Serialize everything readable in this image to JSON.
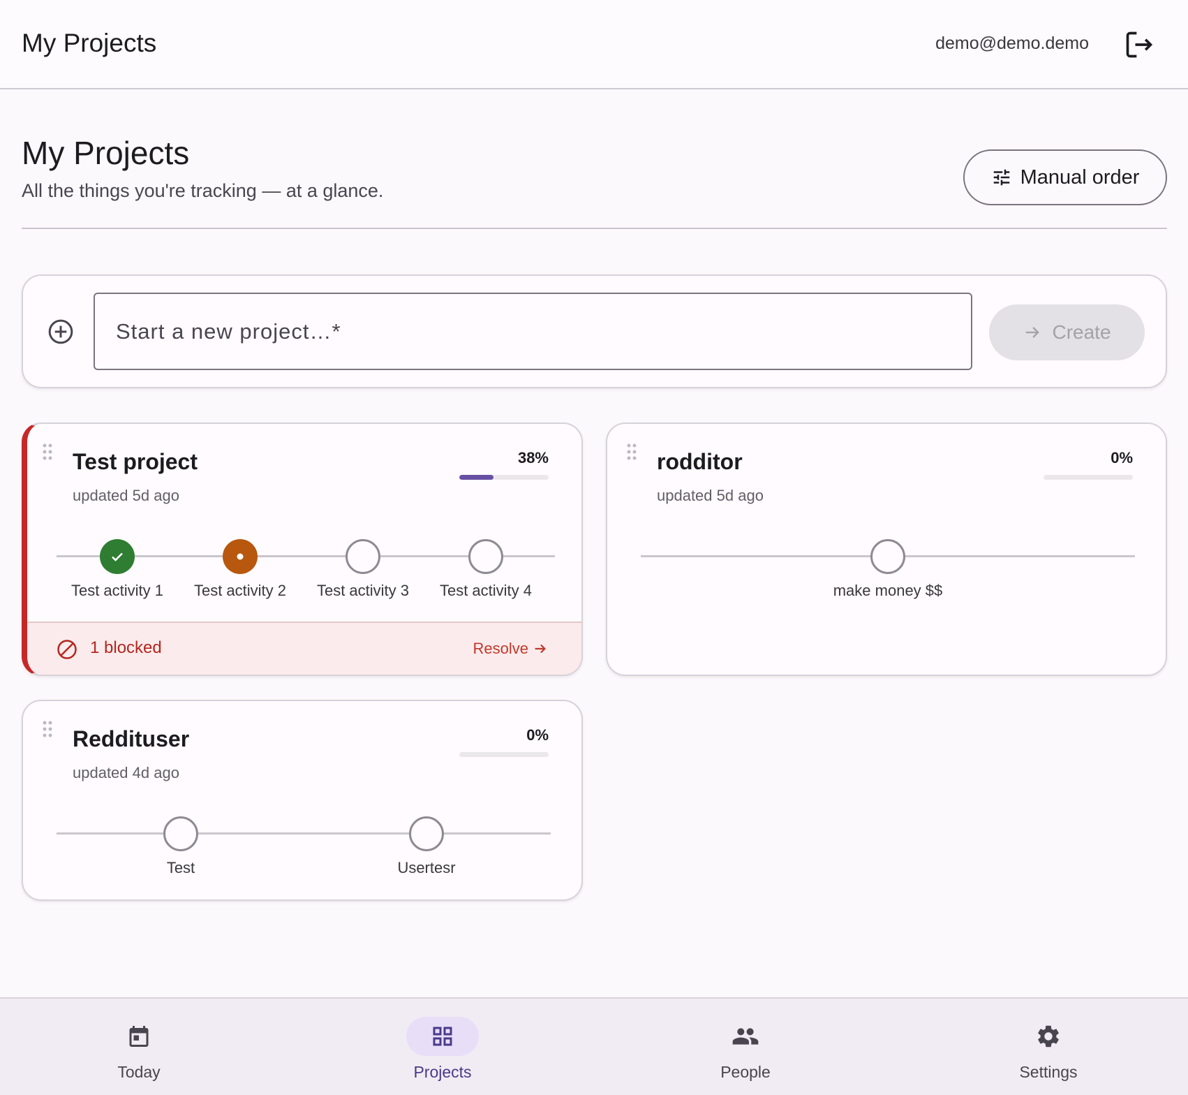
{
  "appbar": {
    "title": "My Projects",
    "user_email": "demo@demo.demo",
    "logout_icon": "logout-icon"
  },
  "header": {
    "title": "My Projects",
    "subtitle": "All the things you're tracking — at a glance.",
    "sort_label": "Manual order",
    "sort_icon": "tune-icon"
  },
  "new_project": {
    "placeholder": "Start a new project…*",
    "create_label": "Create",
    "icons": [
      "add-circle-icon",
      "arrow-forward-icon"
    ]
  },
  "projects": [
    {
      "name": "Test project",
      "updated": "updated 5d ago",
      "percent_label": "38%",
      "progress": 0.38,
      "activities": [
        {
          "label": "Test activity 1",
          "status": "done"
        },
        {
          "label": "Test activity 2",
          "status": "in-progress"
        },
        {
          "label": "Test activity 3",
          "status": "todo"
        },
        {
          "label": "Test activity 4",
          "status": "todo"
        }
      ],
      "blocked_text": "1 blocked",
      "resolve_label": "Resolve"
    },
    {
      "name": "rodditor",
      "updated": "updated 5d ago",
      "percent_label": "0%",
      "progress": 0,
      "activities": [
        {
          "label": "make money $$",
          "status": "todo"
        }
      ]
    },
    {
      "name": "Reddituser",
      "updated": "updated 4d ago",
      "percent_label": "0%",
      "progress": 0,
      "activities": [
        {
          "label": "Test",
          "status": "todo"
        },
        {
          "label": "Usertesr",
          "status": "todo"
        }
      ]
    }
  ],
  "bottom_nav": [
    {
      "label": "Today",
      "icon": "calendar-icon",
      "active": false
    },
    {
      "label": "Projects",
      "icon": "grid-icon",
      "active": true
    },
    {
      "label": "People",
      "icon": "people-icon",
      "active": false
    },
    {
      "label": "Settings",
      "icon": "gear-icon",
      "active": false
    }
  ],
  "colors": {
    "accent": "#6750a4",
    "done": "#2e7d32",
    "in_progress": "#b8570e",
    "blocked": "#c62828"
  }
}
